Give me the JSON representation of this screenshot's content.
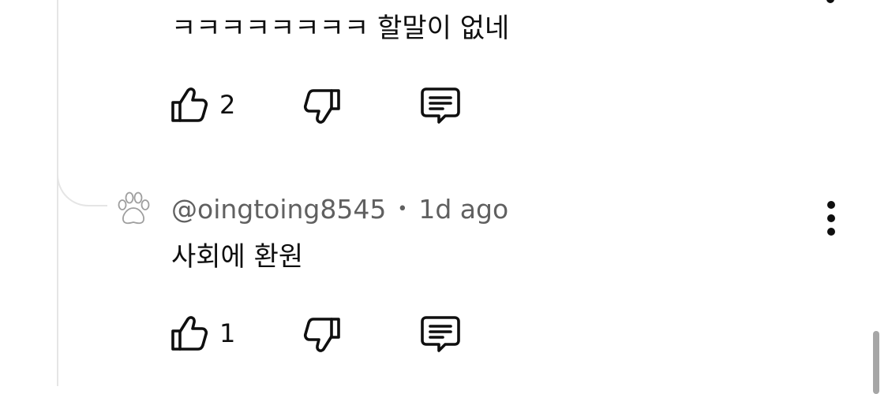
{
  "comment1": {
    "text": "ㅋㅋㅋㅋㅋㅋㅋㅋ 할말이 없네",
    "like_count": "2"
  },
  "comment2": {
    "handle": "@oingtoing8545",
    "separator": "•",
    "time": "1d ago",
    "text": "사회에 환원",
    "like_count": "1"
  },
  "icons": {
    "like": "thumbs-up-icon",
    "dislike": "thumbs-down-icon",
    "reply": "comment-icon",
    "more": "more-vertical-icon",
    "avatar": "paw-icon"
  },
  "colors": {
    "text": "#0f0f0f",
    "meta": "#606060",
    "thread": "#e5e5e5",
    "scrollbar": "#a6a6a6"
  }
}
